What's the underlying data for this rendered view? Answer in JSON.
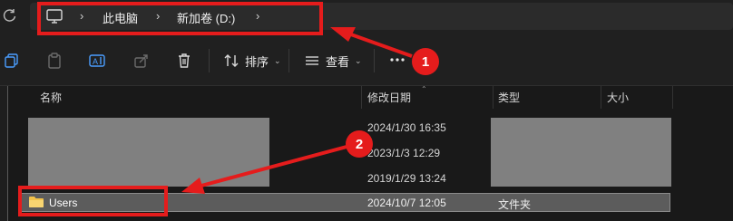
{
  "address_bar": {
    "breadcrumbs": [
      "此电脑",
      "新加卷 (D:)"
    ],
    "root_icon": "computer-icon"
  },
  "toolbar": {
    "sort_label": "排序",
    "view_label": "查看",
    "more_label": "···"
  },
  "columns": {
    "name": "名称",
    "modified": "修改日期",
    "type": "类型",
    "size": "大小"
  },
  "rows": [
    {
      "name": "",
      "modified": "2024/1/30 16:35",
      "type": "",
      "size": ""
    },
    {
      "name": "",
      "modified": "2023/1/3 12:29",
      "type": "",
      "size": ""
    },
    {
      "name": "",
      "modified": "2019/1/29 13:24",
      "type": "",
      "size": ""
    },
    {
      "name": "Users",
      "modified": "2024/10/7 12:05",
      "type": "文件夹",
      "size": ""
    }
  ],
  "annotations": {
    "badge_1": "1",
    "badge_2": "2",
    "color": "#e51c1c"
  },
  "colors": {
    "background": "#191919",
    "toolbar": "#202020",
    "selection": "#5c5c5c",
    "redaction": "#808080",
    "folder": "#f3c34b"
  }
}
